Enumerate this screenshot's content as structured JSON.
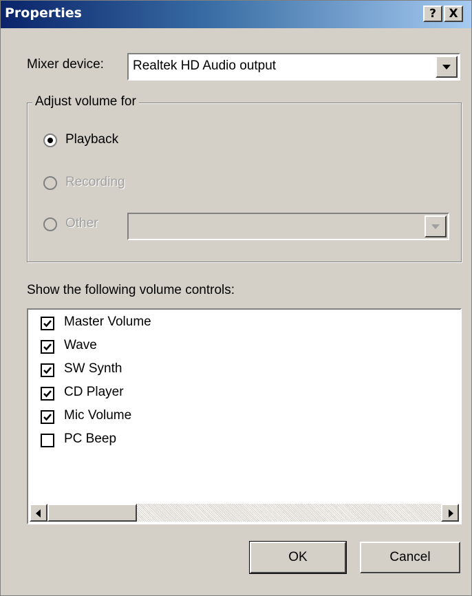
{
  "window": {
    "title": "Properties",
    "help_label": "?",
    "close_label": "X"
  },
  "mixer": {
    "label": "Mixer device:",
    "selected": "Realtek HD Audio output"
  },
  "adjust": {
    "group_label": "Adjust volume for",
    "options": [
      {
        "label": "Playback",
        "selected": true,
        "enabled": true
      },
      {
        "label": "Recording",
        "selected": false,
        "enabled": false
      },
      {
        "label": "Other",
        "selected": false,
        "enabled": false
      }
    ],
    "other_value": ""
  },
  "controls": {
    "label": "Show the following volume controls:",
    "items": [
      {
        "label": "Master Volume",
        "checked": true
      },
      {
        "label": "Wave",
        "checked": true
      },
      {
        "label": "SW Synth",
        "checked": true
      },
      {
        "label": "CD Player",
        "checked": true
      },
      {
        "label": "Mic Volume",
        "checked": true
      },
      {
        "label": "PC Beep",
        "checked": false
      }
    ]
  },
  "buttons": {
    "ok": "OK",
    "cancel": "Cancel"
  }
}
